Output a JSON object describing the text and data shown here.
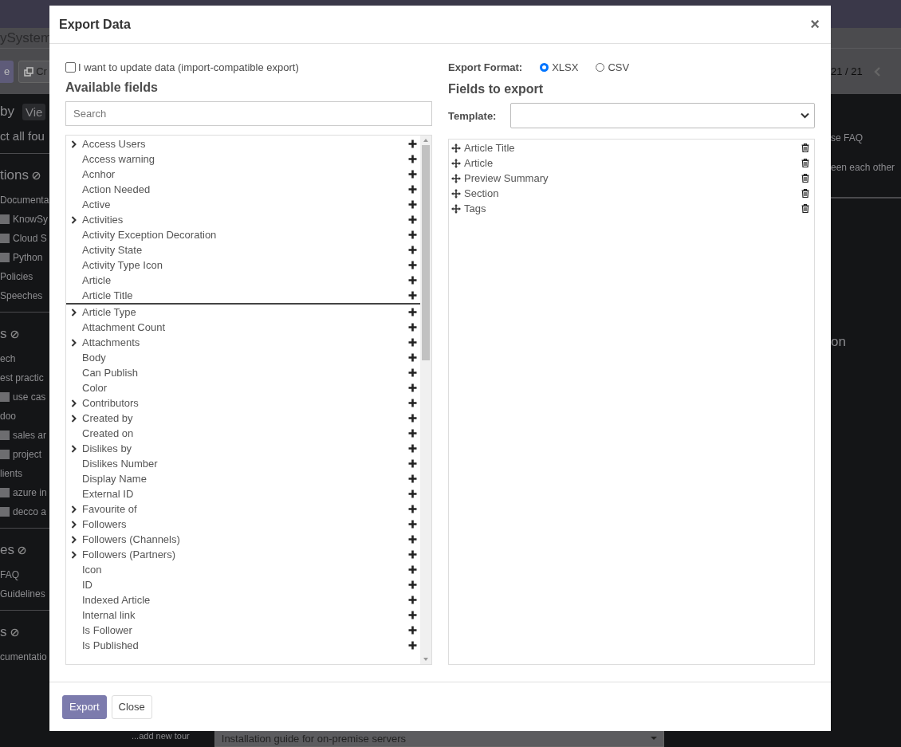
{
  "background": {
    "breadcrumb": "ySystem",
    "sidebar_buttons": [
      "e",
      "Cr"
    ],
    "sidebar_lines": [
      {
        "kind": "chip",
        "label": "by",
        "chip": "Vie"
      },
      {
        "kind": "text",
        "label": "ct all fou"
      },
      {
        "kind": "divider"
      },
      {
        "kind": "heading",
        "label": "tions"
      },
      {
        "kind": "text",
        "label": "Documenta"
      },
      {
        "kind": "check",
        "label": "KnowSy",
        "checked": false
      },
      {
        "kind": "check",
        "label": "Cloud S",
        "checked": false
      },
      {
        "kind": "check",
        "label": "Python",
        "checked": false
      },
      {
        "kind": "text",
        "label": "Policies"
      },
      {
        "kind": "text",
        "label": "Speeches"
      },
      {
        "kind": "divider"
      },
      {
        "kind": "heading",
        "label": "s"
      },
      {
        "kind": "text",
        "label": "ech"
      },
      {
        "kind": "text",
        "label": "est practic"
      },
      {
        "kind": "check",
        "label": "use cas",
        "checked": false
      },
      {
        "kind": "text",
        "label": "doo"
      },
      {
        "kind": "check",
        "label": "sales ar",
        "checked": false
      },
      {
        "kind": "check",
        "label": "project",
        "checked": false
      },
      {
        "kind": "text",
        "label": "lients"
      },
      {
        "kind": "check",
        "label": "azure in",
        "checked": false
      },
      {
        "kind": "check",
        "label": "decco a",
        "checked": false
      },
      {
        "kind": "divider"
      },
      {
        "kind": "heading",
        "label": "es"
      },
      {
        "kind": "text",
        "label": "FAQ"
      },
      {
        "kind": "text",
        "label": "Guidelines"
      },
      {
        "kind": "divider"
      },
      {
        "kind": "heading",
        "label": "s"
      },
      {
        "kind": "text",
        "label": "cumentatio"
      }
    ],
    "add_tour": "...add new tour",
    "bottom_select": "Installation guide for on-premise servers",
    "pager": "21 / 21",
    "right_lines": [
      "se FAQ",
      "een each other",
      "on"
    ]
  },
  "dialog": {
    "title": "Export Data",
    "close": "×",
    "import_compatible": {
      "label": "I want to update data (import-compatible export)",
      "checked": false
    },
    "available_title": "Available fields",
    "search": {
      "placeholder": "Search"
    },
    "fields": [
      {
        "label": "Access Users",
        "expandable": true,
        "selected": false
      },
      {
        "label": "Access warning",
        "expandable": false,
        "selected": false
      },
      {
        "label": "Acnhor",
        "expandable": false,
        "selected": false
      },
      {
        "label": "Action Needed",
        "expandable": false,
        "selected": false
      },
      {
        "label": "Active",
        "expandable": false,
        "selected": false
      },
      {
        "label": "Activities",
        "expandable": true,
        "selected": false
      },
      {
        "label": "Activity Exception Decoration",
        "expandable": false,
        "selected": false
      },
      {
        "label": "Activity State",
        "expandable": false,
        "selected": false
      },
      {
        "label": "Activity Type Icon",
        "expandable": false,
        "selected": false
      },
      {
        "label": "Article",
        "expandable": false,
        "selected": false
      },
      {
        "label": "Article Title",
        "expandable": false,
        "selected": true
      },
      {
        "label": "Article Type",
        "expandable": true,
        "selected": false
      },
      {
        "label": "Attachment Count",
        "expandable": false,
        "selected": false
      },
      {
        "label": "Attachments",
        "expandable": true,
        "selected": false
      },
      {
        "label": "Body",
        "expandable": false,
        "selected": false
      },
      {
        "label": "Can Publish",
        "expandable": false,
        "selected": false
      },
      {
        "label": "Color",
        "expandable": false,
        "selected": false
      },
      {
        "label": "Contributors",
        "expandable": true,
        "selected": false
      },
      {
        "label": "Created by",
        "expandable": true,
        "selected": false
      },
      {
        "label": "Created on",
        "expandable": false,
        "selected": false
      },
      {
        "label": "Dislikes by",
        "expandable": true,
        "selected": false
      },
      {
        "label": "Dislikes Number",
        "expandable": false,
        "selected": false
      },
      {
        "label": "Display Name",
        "expandable": false,
        "selected": false
      },
      {
        "label": "External ID",
        "expandable": false,
        "selected": false
      },
      {
        "label": "Favourite of",
        "expandable": true,
        "selected": false
      },
      {
        "label": "Followers",
        "expandable": true,
        "selected": false
      },
      {
        "label": "Followers (Channels)",
        "expandable": true,
        "selected": false
      },
      {
        "label": "Followers (Partners)",
        "expandable": true,
        "selected": false
      },
      {
        "label": "Icon",
        "expandable": false,
        "selected": false
      },
      {
        "label": "ID",
        "expandable": false,
        "selected": false
      },
      {
        "label": "Indexed Article",
        "expandable": false,
        "selected": false
      },
      {
        "label": "Internal link",
        "expandable": false,
        "selected": false
      },
      {
        "label": "Is Follower",
        "expandable": false,
        "selected": false
      },
      {
        "label": "Is Published",
        "expandable": false,
        "selected": false
      }
    ],
    "format_label": "Export Format:",
    "formats": [
      {
        "label": "XLSX",
        "selected": true
      },
      {
        "label": "CSV",
        "selected": false
      }
    ],
    "export_title": "Fields to export",
    "template_label": "Template:",
    "export_fields": [
      "Article Title",
      "Article",
      "Preview Summary",
      "Section",
      "Tags"
    ],
    "buttons": [
      {
        "label": "Export",
        "kind": "primary"
      },
      {
        "label": "Close",
        "kind": "secondary"
      }
    ]
  }
}
